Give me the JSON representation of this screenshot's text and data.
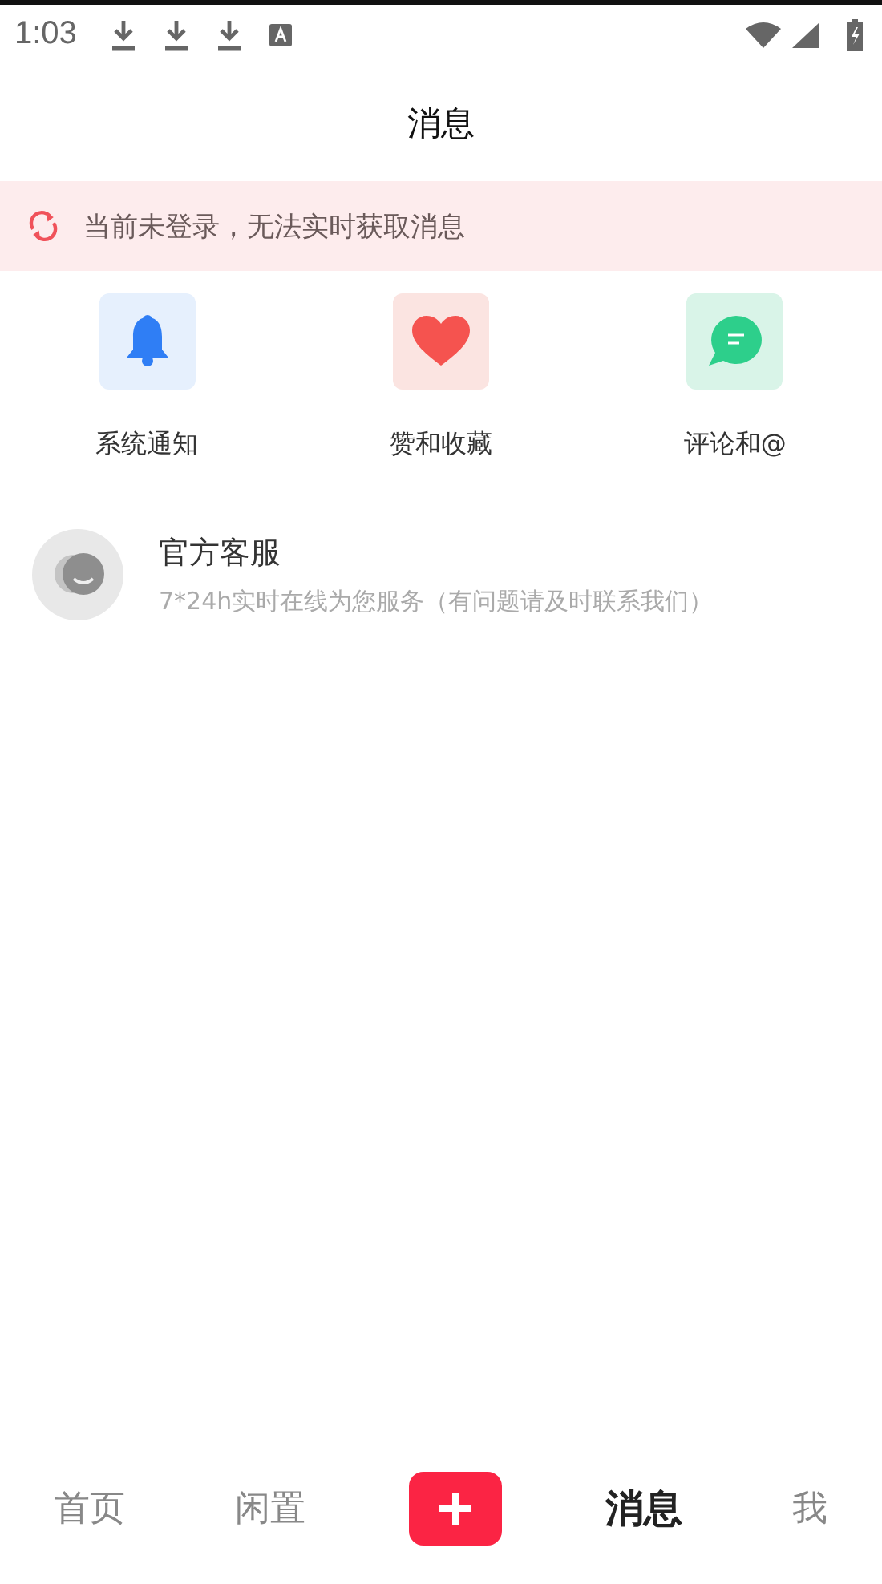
{
  "status_bar": {
    "time": "1:03"
  },
  "header": {
    "title": "消息"
  },
  "notice": {
    "text": "当前未登录，无法实时获取消息"
  },
  "categories": [
    {
      "kind": "bell",
      "label": "系统通知"
    },
    {
      "kind": "heart",
      "label": "赞和收藏"
    },
    {
      "kind": "comment",
      "label": "评论和@"
    }
  ],
  "conversations": [
    {
      "name": "官方客服",
      "preview": "7*24h实时在线为您服务（有问题请及时联系我们）"
    }
  ],
  "bottom_nav": [
    {
      "kind": "tab",
      "label": "首页",
      "selected": false
    },
    {
      "kind": "tab",
      "label": "闲置",
      "selected": false
    },
    {
      "kind": "add"
    },
    {
      "kind": "tab",
      "label": "消息",
      "selected": true
    },
    {
      "kind": "tab",
      "label": "我",
      "selected": false
    }
  ]
}
